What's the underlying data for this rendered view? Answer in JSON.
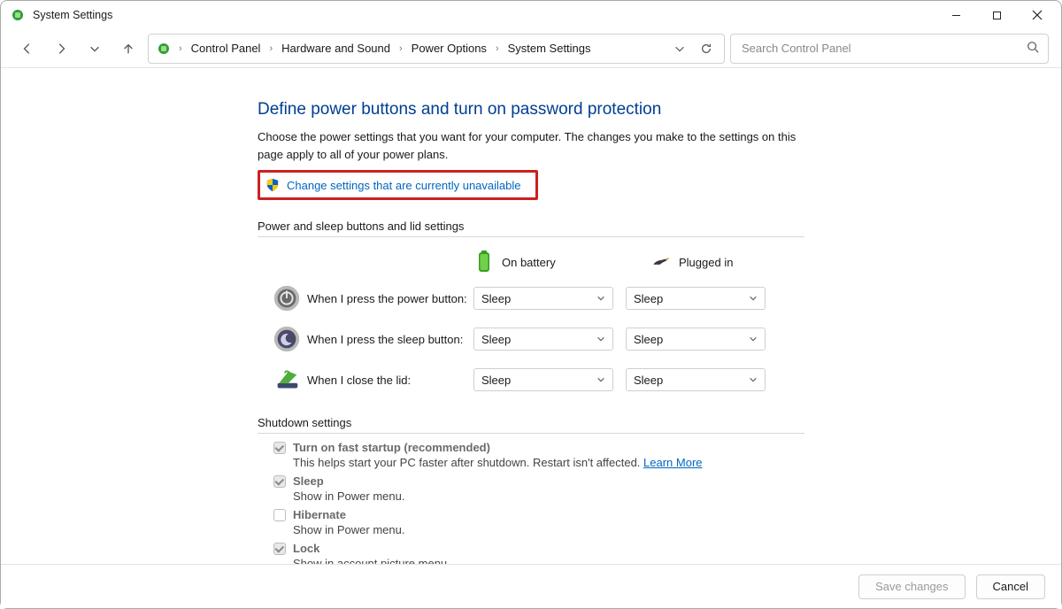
{
  "window": {
    "title": "System Settings"
  },
  "breadcrumbs": {
    "items": [
      "Control Panel",
      "Hardware and Sound",
      "Power Options",
      "System Settings"
    ]
  },
  "search": {
    "placeholder": "Search Control Panel"
  },
  "page": {
    "title": "Define power buttons and turn on password protection",
    "intro": "Choose the power settings that you want for your computer. The changes you make to the settings on this page apply to all of your power plans.",
    "change_link": "Change settings that are currently unavailable",
    "section_power_sleep": "Power and sleep buttons and lid settings",
    "section_shutdown": "Shutdown settings",
    "col_on_battery": "On battery",
    "col_plugged_in": "Plugged in"
  },
  "settings_rows": [
    {
      "label": "When I press the power button:",
      "on_battery": "Sleep",
      "plugged_in": "Sleep"
    },
    {
      "label": "When I press the sleep button:",
      "on_battery": "Sleep",
      "plugged_in": "Sleep"
    },
    {
      "label": "When I close the lid:",
      "on_battery": "Sleep",
      "plugged_in": "Sleep"
    }
  ],
  "shutdown": {
    "items": [
      {
        "title": "Turn on fast startup (recommended)",
        "desc": "This helps start your PC faster after shutdown. Restart isn't affected. ",
        "learn_more": "Learn More",
        "checked": true
      },
      {
        "title": "Sleep",
        "desc": "Show in Power menu.",
        "checked": true
      },
      {
        "title": "Hibernate",
        "desc": "Show in Power menu.",
        "checked": false
      },
      {
        "title": "Lock",
        "desc": "Show in account picture menu.",
        "checked": true
      }
    ]
  },
  "footer": {
    "save": "Save changes",
    "cancel": "Cancel"
  }
}
